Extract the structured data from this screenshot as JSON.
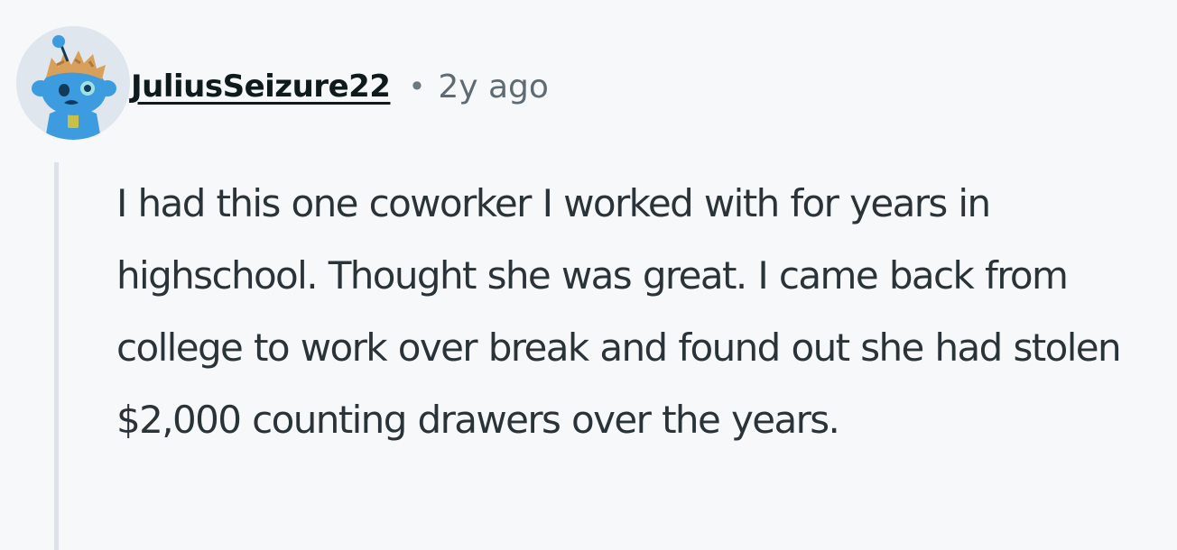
{
  "comment": {
    "username": "JuliusSeizure22",
    "separator": "•",
    "timestamp": "2y ago",
    "body": "I had this one coworker I worked with for years in highschool. Thought she was great. I came back from college to work over break and found out she had stolen $2,000 counting drawers over the years."
  },
  "colors": {
    "background": "#f7f8fa",
    "text": "#2a3338",
    "username": "#0f1a1c",
    "muted": "#5f6b73",
    "thread_line": "#dde2e8",
    "avatar_bg": "#dfe6ee",
    "snoo_blue": "#3d9be0"
  },
  "icons": {
    "avatar": "snoo-avatar"
  }
}
